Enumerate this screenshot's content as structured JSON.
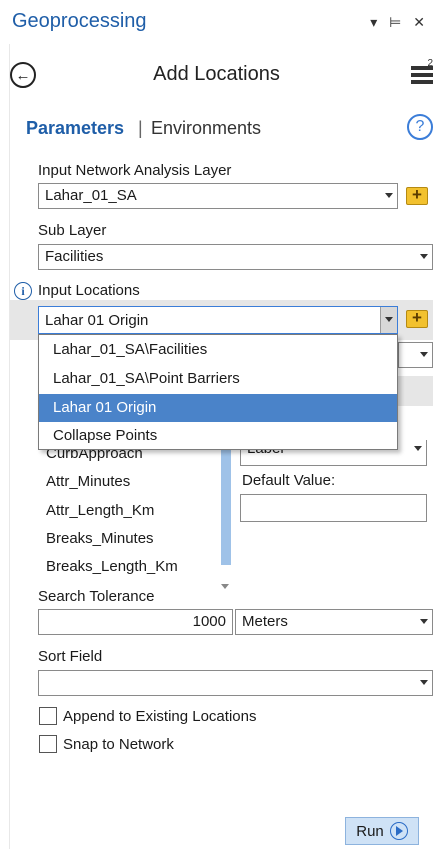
{
  "pane": {
    "title": "Geoprocessing",
    "controls": "▾ ⊨ ✕"
  },
  "tool": {
    "title": "Add Locations"
  },
  "tabs": {
    "parameters": "Parameters",
    "separator": "|",
    "environments": "Environments"
  },
  "params": {
    "input_network_label": "Input Network Analysis Layer",
    "input_network_value": "Lahar_01_SA",
    "sub_layer_label": "Sub Layer",
    "sub_layer_value": "Facilities",
    "input_locations_label": "Input Locations",
    "input_locations_value": "Lahar 01 Origin",
    "search_tolerance_label": "Search Tolerance",
    "search_tolerance_value": "1000",
    "search_tolerance_unit": "Meters",
    "sort_field_label": "Sort Field",
    "sort_field_value": "",
    "append_label": "Append to Existing Locations",
    "snap_label": "Snap to Network",
    "field_mapping_property": "Label",
    "default_value_label": "Default Value:",
    "default_value": ""
  },
  "dropdown": {
    "items": [
      "Lahar_01_SA\\Facilities",
      "Lahar_01_SA\\Point Barriers",
      "Lahar 01 Origin",
      "Collapse Points"
    ],
    "selected_index": 2
  },
  "field_list": [
    "CurbApproach",
    "Attr_Minutes",
    "Attr_Length_Km",
    "Breaks_Minutes",
    "Breaks_Length_Km"
  ],
  "footer": {
    "run_label": "Run"
  },
  "colors": {
    "accent": "#1f5ea8",
    "selection": "#4a83c9",
    "run_button": "#cfe2f6"
  }
}
